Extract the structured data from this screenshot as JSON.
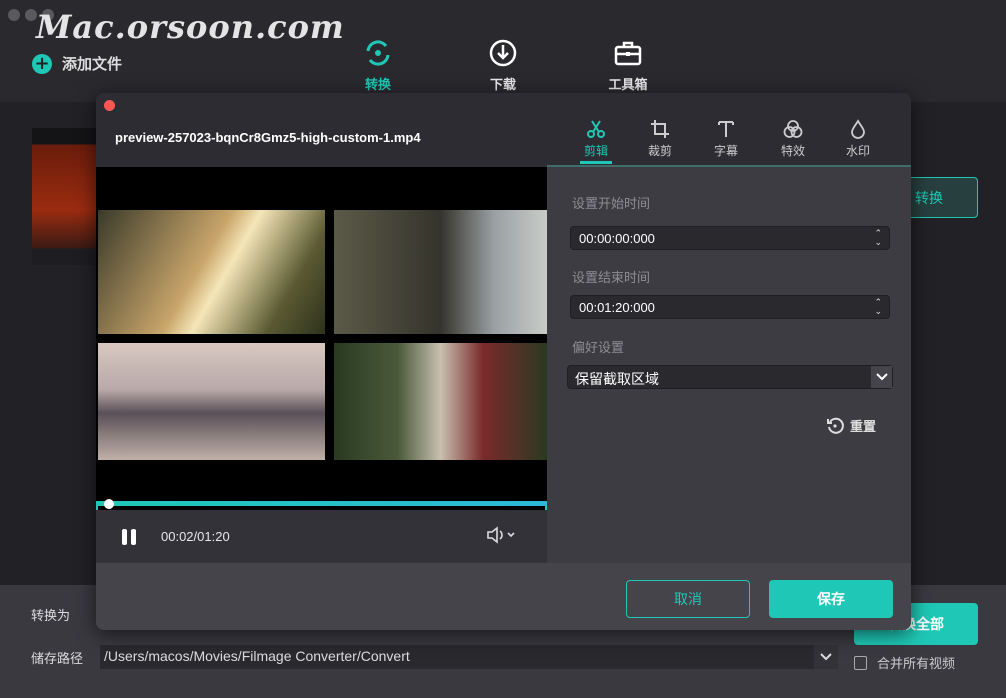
{
  "watermark": "Mac.orsoon.com",
  "toolbar": {
    "add_file": "添加文件",
    "nav": [
      {
        "label": "转换",
        "icon": "convert-icon",
        "active": true
      },
      {
        "label": "下载",
        "icon": "download-icon",
        "active": false
      },
      {
        "label": "工具箱",
        "icon": "toolbox-icon",
        "active": false
      }
    ]
  },
  "main": {
    "convert_button_partial": "转换"
  },
  "bottom": {
    "convert_to_label": "转换为",
    "save_path_label": "储存路径",
    "save_path_value": "/Users/macos/Movies/Filmage Converter/Convert",
    "convert_all_partial": "转换全部",
    "merge_label": "合并所有视频",
    "merge_checked": false
  },
  "dialog": {
    "filename": "preview-257023-bqnCr8Gmz5-high-custom-1.mp4",
    "tabs": [
      {
        "label": "剪辑",
        "icon": "scissors-icon",
        "active": true
      },
      {
        "label": "裁剪",
        "icon": "crop-icon",
        "active": false
      },
      {
        "label": "字幕",
        "icon": "text-icon",
        "active": false
      },
      {
        "label": "特效",
        "icon": "effects-icon",
        "active": false
      },
      {
        "label": "水印",
        "icon": "watermark-drop-icon",
        "active": false
      }
    ],
    "player": {
      "time": "00:02/01:20",
      "progress_percent": 2.5
    },
    "trim": {
      "start_label": "设置开始时间",
      "start_value": "00:00:00:000",
      "end_label": "设置结束时间",
      "end_value": "00:01:20:000",
      "pref_label": "偏好设置",
      "pref_value": "保留截取区域",
      "reset_label": "重置"
    },
    "cancel_label": "取消",
    "save_label": "保存"
  },
  "colors": {
    "accent": "#1fc8b6",
    "close": "#fc5753"
  }
}
